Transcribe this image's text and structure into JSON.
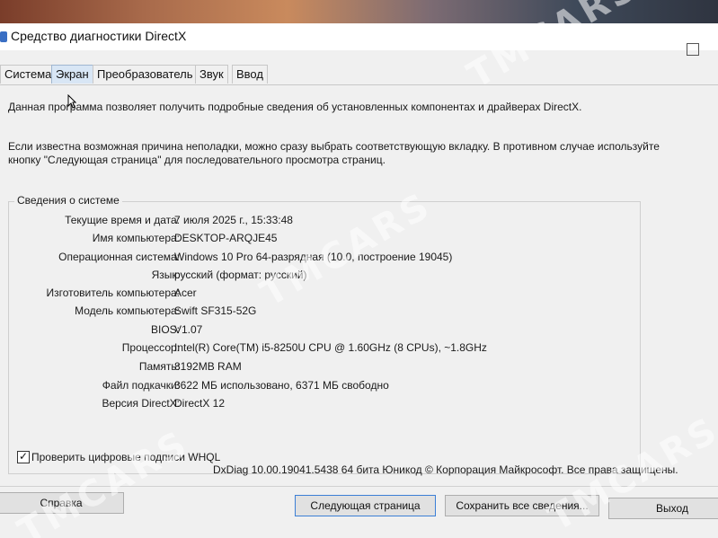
{
  "window": {
    "title": "Средство диагностики DirectX"
  },
  "tabs": [
    {
      "label": "Система",
      "active": false
    },
    {
      "label": "Экран",
      "active": true
    },
    {
      "label": "Преобразователь",
      "active": false
    },
    {
      "label": "Звук",
      "active": false
    },
    {
      "label": "Ввод",
      "active": false
    }
  ],
  "intro": {
    "line1": "Данная программа позволяет получить подробные сведения об установленных компонентах и драйверах DirectX.",
    "line2": "Если известна возможная причина неполадки, можно сразу выбрать соответствующую вкладку. В противном случае используйте",
    "line3": "кнопку \"Следующая страница\" для последовательного просмотра страниц."
  },
  "system_info": {
    "group_title": "Сведения о системе",
    "rows": [
      {
        "label": "Текущие время и дата:",
        "value": "7 июля 2025 г., 15:33:48"
      },
      {
        "label": "Имя компьютера:",
        "value": "DESKTOP-ARQJE45"
      },
      {
        "label": "Операционная система:",
        "value": "Windows 10 Pro 64-разрядная (10.0, построение 19045)"
      },
      {
        "label": "Язык:",
        "value": "русский (формат: русский)"
      },
      {
        "label": "Изготовитель компьютера:",
        "value": "Acer"
      },
      {
        "label": "Модель компьютера:",
        "value": "Swift SF315-52G"
      },
      {
        "label": "BIOS:",
        "value": "V1.07"
      },
      {
        "label": "Процессор:",
        "value": "Intel(R) Core(TM) i5-8250U CPU @ 1.60GHz (8 CPUs), ~1.8GHz"
      },
      {
        "label": "Память:",
        "value": "8192MB RAM"
      },
      {
        "label": "Файл подкачки:",
        "value": "3622 МБ использовано, 6371 МБ свободно"
      },
      {
        "label": "Версия DirectX:",
        "value": "DirectX 12"
      }
    ]
  },
  "whql_checkbox": {
    "label": "Проверить цифровые подписи WHQL",
    "checked": true
  },
  "footer": {
    "copyright": "DxDiag 10.00.19041.5438 64 бита Юникод © Корпорация Майкрософт. Все права защищены."
  },
  "buttons": {
    "help": "Справка",
    "next_page": "Следующая страница",
    "save_all": "Сохранить все сведения...",
    "exit": "Выход"
  },
  "watermark": "TMCARS",
  "colors": {
    "window_bg": "#f0f0f0",
    "active_tab": "#d8e6f5",
    "primary_button_border": "#3c7fd6"
  }
}
